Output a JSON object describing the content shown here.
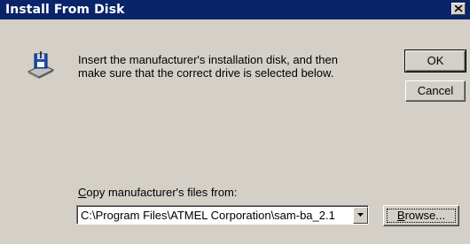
{
  "window": {
    "title": "Install From Disk",
    "close_icon": "close-icon"
  },
  "message": {
    "line1": "Insert the manufacturer's installation disk, and then",
    "line2": "make sure that the correct drive is selected below.",
    "icon": "install-disk-icon"
  },
  "buttons": {
    "ok": "OK",
    "cancel": "Cancel",
    "browse": "Browse..."
  },
  "copy_from": {
    "label": "Copy manufacturer's files from:",
    "accelerator": "C",
    "label_rest": "opy manufacturer's files from:",
    "value": "C:\\Program Files\\ATMEL Corporation\\sam-ba_2.1",
    "dropdown_icon": "chevron-down-icon"
  },
  "browse_accel": "B",
  "browse_rest": "rowse..."
}
